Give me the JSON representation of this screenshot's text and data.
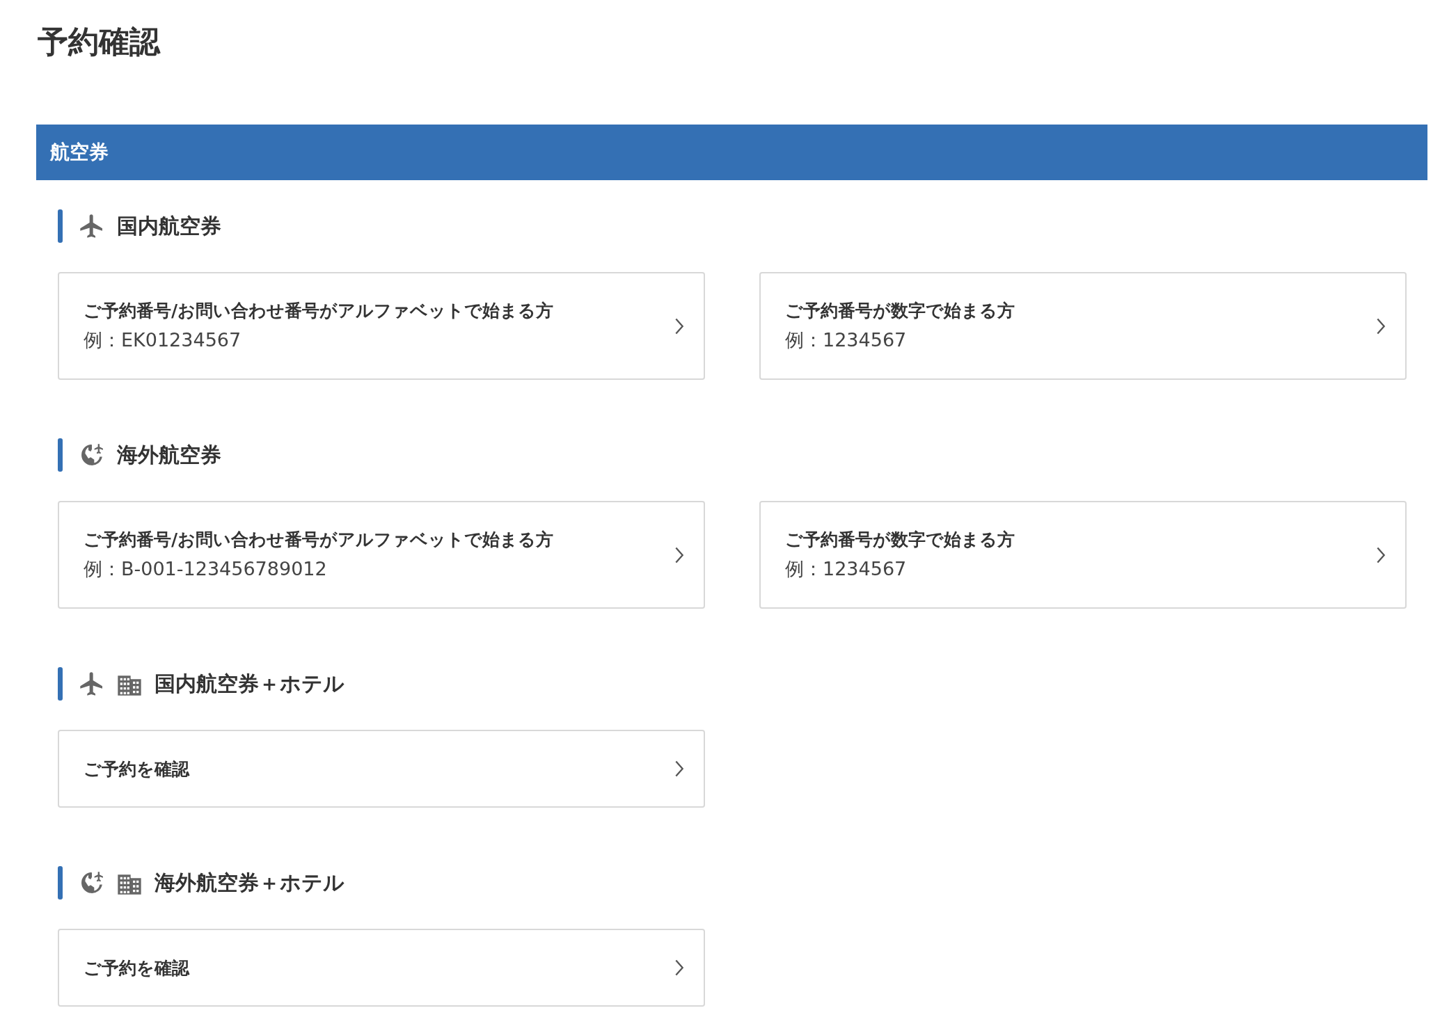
{
  "page_title": "予約確認",
  "category": {
    "title": "航空券"
  },
  "sections": [
    {
      "title": "国内航空券",
      "icons": [
        {
          "kind": "plane"
        }
      ],
      "cards": [
        {
          "title": "ご予約番号/お問い合わせ番号がアルファベットで始まる方",
          "example": "例：EK01234567"
        },
        {
          "title": "ご予約番号が数字で始まる方",
          "example": "例：1234567"
        }
      ]
    },
    {
      "title": "海外航空券",
      "icons": [
        {
          "kind": "globe"
        }
      ],
      "cards": [
        {
          "title": "ご予約番号/お問い合わせ番号がアルファベットで始まる方",
          "example": "例：B-001-123456789012"
        },
        {
          "title": "ご予約番号が数字で始まる方",
          "example": "例：1234567"
        }
      ]
    },
    {
      "title": "国内航空券＋ホテル",
      "icons": [
        {
          "kind": "plane"
        },
        {
          "kind": "building"
        }
      ],
      "cards": [
        {
          "title": "ご予約を確認"
        }
      ]
    },
    {
      "title": "海外航空券＋ホテル",
      "icons": [
        {
          "kind": "globe"
        },
        {
          "kind": "building"
        }
      ],
      "cards": [
        {
          "title": "ご予約を確認"
        }
      ]
    }
  ]
}
